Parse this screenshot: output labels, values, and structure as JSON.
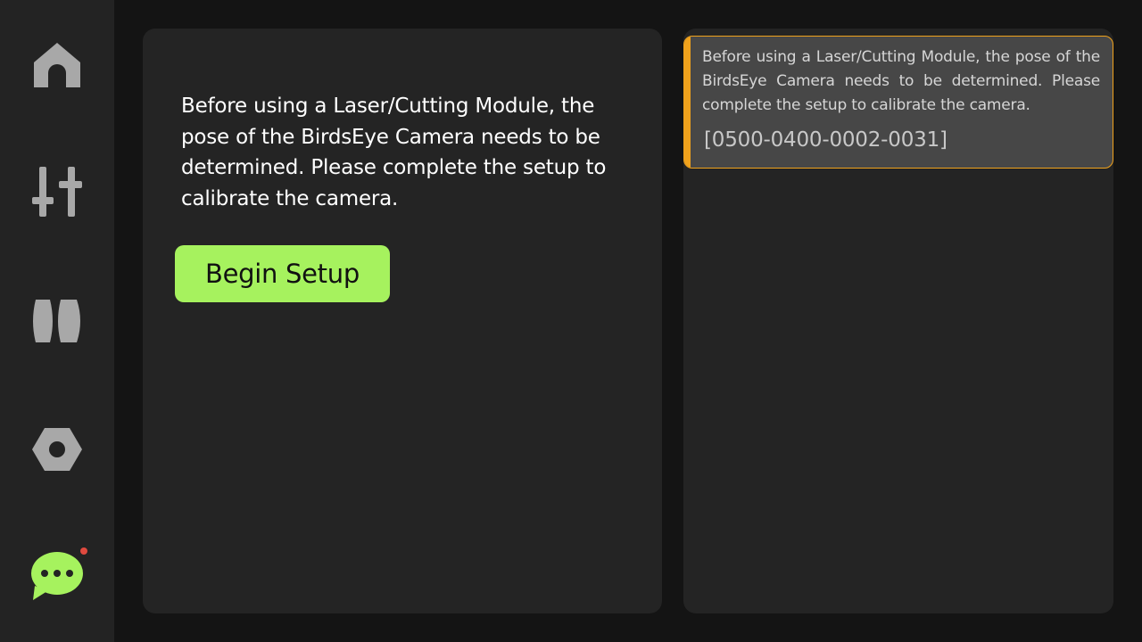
{
  "colors": {
    "accent_green": "#a6f25e",
    "warning_orange": "#f0a21c",
    "badge_red": "#e04a3f",
    "icon_gray": "#a8a8a8"
  },
  "sidebar": {
    "items": [
      {
        "name": "home",
        "icon": "home-icon",
        "active": false
      },
      {
        "name": "controls",
        "icon": "sliders-icon",
        "active": false
      },
      {
        "name": "modules",
        "icon": "module-icon",
        "active": false
      },
      {
        "name": "settings",
        "icon": "settings-icon",
        "active": false
      },
      {
        "name": "messages",
        "icon": "chat-icon",
        "active": true,
        "has_notification": true
      }
    ]
  },
  "main": {
    "message": "Before using a Laser/Cutting Module, the pose of the BirdsEye Camera needs to be determined. Please complete the setup to calibrate the camera.",
    "button_label": "Begin Setup"
  },
  "notifications": [
    {
      "text": "Before using a Laser/Cutting Module, the pose of the BirdsEye Camera needs to be determined. Please complete the setup to calibrate the camera.",
      "code": "[0500-0400-0002-0031]"
    }
  ]
}
